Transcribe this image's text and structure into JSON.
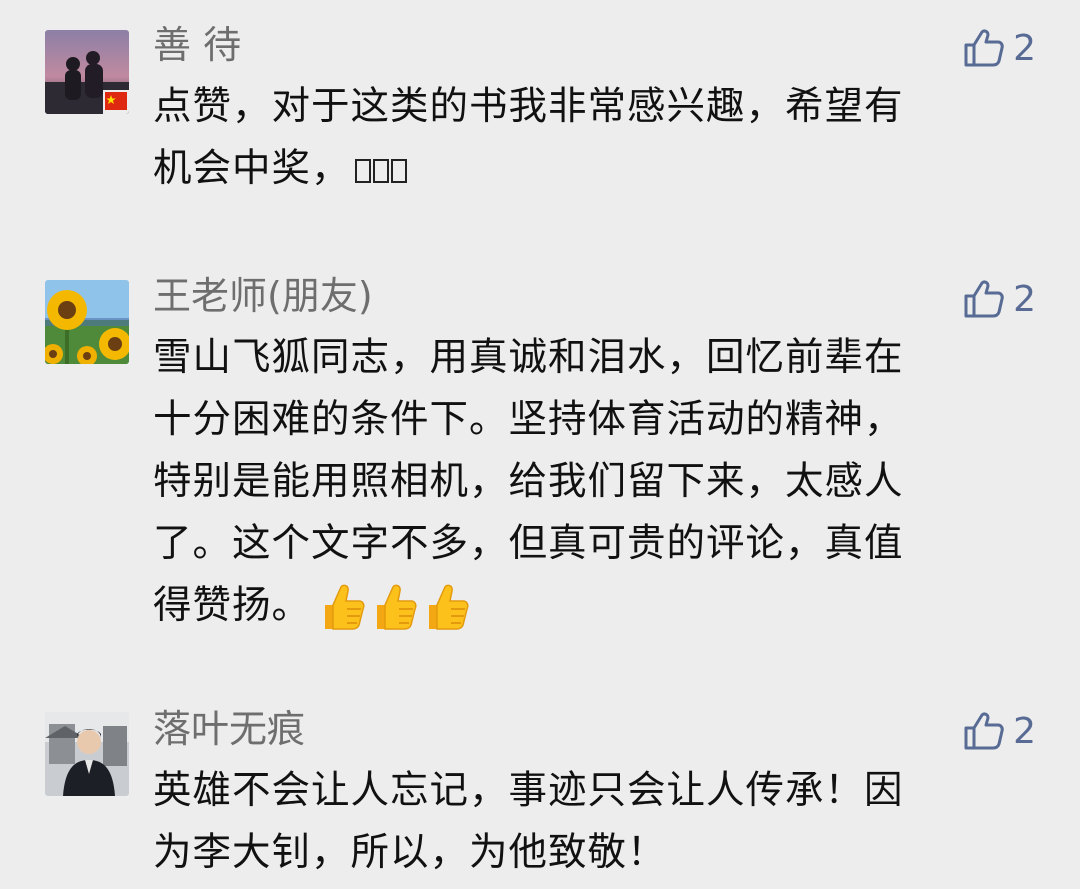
{
  "comments": [
    {
      "name": "善 待",
      "likes": "2",
      "lines": [
        "点赞，对于这类的书我非常感兴趣，希望有",
        "机会中奖，"
      ],
      "trailing_glyphs": 3
    },
    {
      "name": "王老师(朋友)",
      "likes": "2",
      "lines": [
        "雪山飞狐同志，用真诚和泪水，回忆前辈在",
        "十分困难的条件下。坚持体育活动的精神，",
        "特别是能用照相机，给我们留下来，太感人",
        "了。这个文字不多，但真可贵的评论，真值",
        "得赞扬。"
      ],
      "trailing_emoji": [
        "thumbs-up",
        "thumbs-up",
        "thumbs-up"
      ]
    },
    {
      "name": "落叶无痕",
      "likes": "2",
      "lines": [
        "英雄不会让人忘记，事迹只会让人传承！因",
        "为李大钊，所以，为他致敬！"
      ]
    }
  ],
  "colors": {
    "background": "#ededed",
    "name": "#6e6e6e",
    "like_accent": "#576b95",
    "text": "#111111"
  },
  "icons": {
    "like": "thumb-up-outline-icon",
    "emoji": "thumbs-up-emoji-icon",
    "flag": "china-flag-icon"
  }
}
